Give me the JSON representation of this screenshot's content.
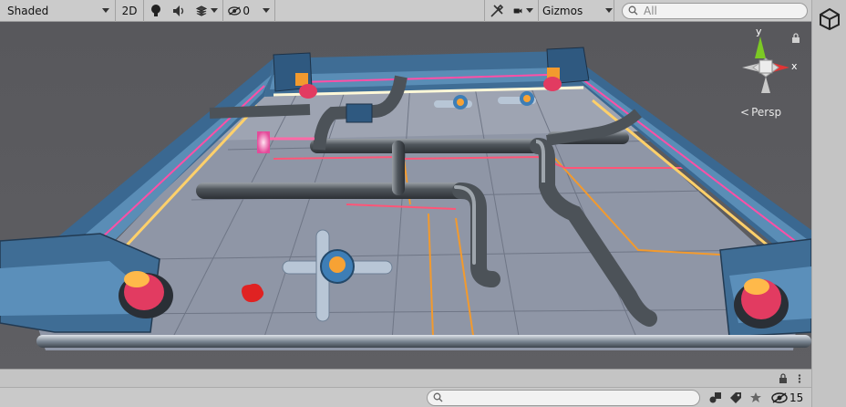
{
  "toolbar": {
    "draw_mode": "Shaded",
    "mode_2d": "2D",
    "hidden_count": "0",
    "gizmos": "Gizmos",
    "search_placeholder": "All"
  },
  "viewport": {
    "projection": "Persp",
    "axis_x": "x",
    "axis_y": "y"
  },
  "status": {
    "hidden_layers": "15"
  }
}
